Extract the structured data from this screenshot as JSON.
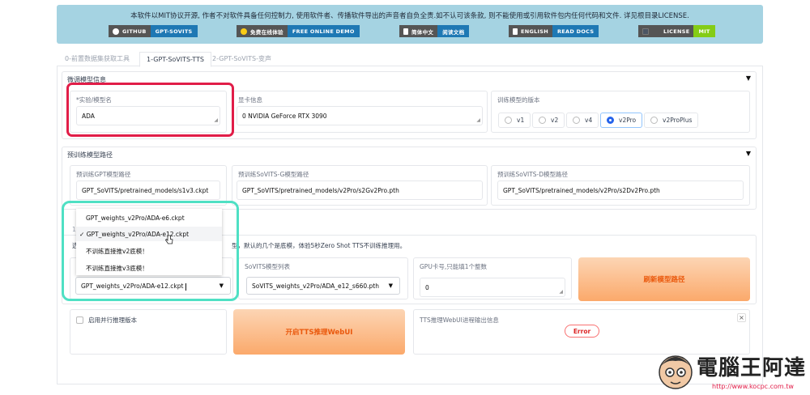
{
  "banner": {
    "notice": "本软件以MIT协议开源, 作者不对软件具备任何控制力, 使用软件者、传播软件导出的声音者自负全责.如不认可该条款, 则不能使用或引用软件包内任何代码和文件. 详见根目录LICENSE.",
    "badges": [
      {
        "left": "GITHUB",
        "right": "GPT-SOVITS",
        "color": "#1e78b4",
        "icon": "github-icon"
      },
      {
        "left": "免费在线体验",
        "right": "FREE ONLINE DEMO",
        "color": "#1e78b4",
        "icon": "hugging-face-icon"
      },
      {
        "left": "简体中文",
        "right": "阅读文档",
        "color": "#1e78b4",
        "icon": "doc-icon"
      },
      {
        "left": "ENGLISH",
        "right": "READ DOCS",
        "color": "#1e78b4",
        "icon": "doc-icon"
      },
      {
        "left": "LICENSE",
        "right": "MIT",
        "color": "#84cc16",
        "icon": "license-icon"
      }
    ]
  },
  "tabs": [
    "0-前置数据集获取工具",
    "1-GPT-SoVITS-TTS",
    "2-GPT-SoVITS-变声"
  ],
  "active_tab": "1-GPT-SoVITS-TTS",
  "model_info": {
    "title": "微调模型信息",
    "exp_label": "*实验/模型名",
    "exp_value": "ADA",
    "gpu_label": "显卡信息",
    "gpu_value": "0 NVIDIA GeForce RTX 3090",
    "version_label": "训练模型的版本",
    "versions": [
      "v1",
      "v2",
      "v4",
      "v2Pro",
      "v2ProPlus"
    ],
    "selected_version": "v2Pro"
  },
  "pretrained": {
    "title": "预训练模型路径",
    "gpt_label": "预训练GPT模型路径",
    "gpt_value": "GPT_SoVITS/pretrained_models/s1v3.ckpt",
    "sovits_g_label": "预训练SoVITS-G模型路径",
    "sovits_g_value": "GPT_SoVITS/pretrained_models/v2Pro/s2Gv2Pro.pth",
    "sovits_d_label": "预训练SoVITS-D模型路径",
    "sovits_d_value": "GPT_SoVITS/pretrained_models/v2Pro/s2Dv2Pro.pth"
  },
  "inference": {
    "section_prefix": "1C",
    "hint_prefix": "选",
    "hint": "型，默认的几个是底模，体验5秒Zero Shot TTS不训练推理用。",
    "gpt_selected": "GPT_weights_v2Pro/ADA-e12.ckpt",
    "sovits_label": "SoVITS模型列表",
    "sovits_selected": "SoVITS_weights_v2Pro/ADA_e12_s660.pth",
    "gpu_label": "GPU卡号,只能填1个整数",
    "gpu_value": "0",
    "refresh_button": "刷新模型路径",
    "parallel_label": "启用并行推理版本",
    "open_webui_button": "开启TTS推理WebUI",
    "output_label": "TTS推理WebUI进程输出信息",
    "error_badge": "Error",
    "close_glyph": "×"
  },
  "dropdown": {
    "check": "✓",
    "options": [
      "GPT_weights_v2Pro/ADA-e6.ckpt",
      "GPT_weights_v2Pro/ADA-e12.ckpt",
      "不训练直接推v2底模！",
      "不训练直接推v3底模！"
    ],
    "selected_index": 1
  },
  "watermark": {
    "text": "電腦王阿達",
    "url": "http://www.kocpc.com.tw"
  },
  "colors": {
    "highlight_red": "#e11d48",
    "highlight_green": "#4fe0c4",
    "accent_blue": "#2563eb",
    "orange_text": "#ea580c"
  }
}
